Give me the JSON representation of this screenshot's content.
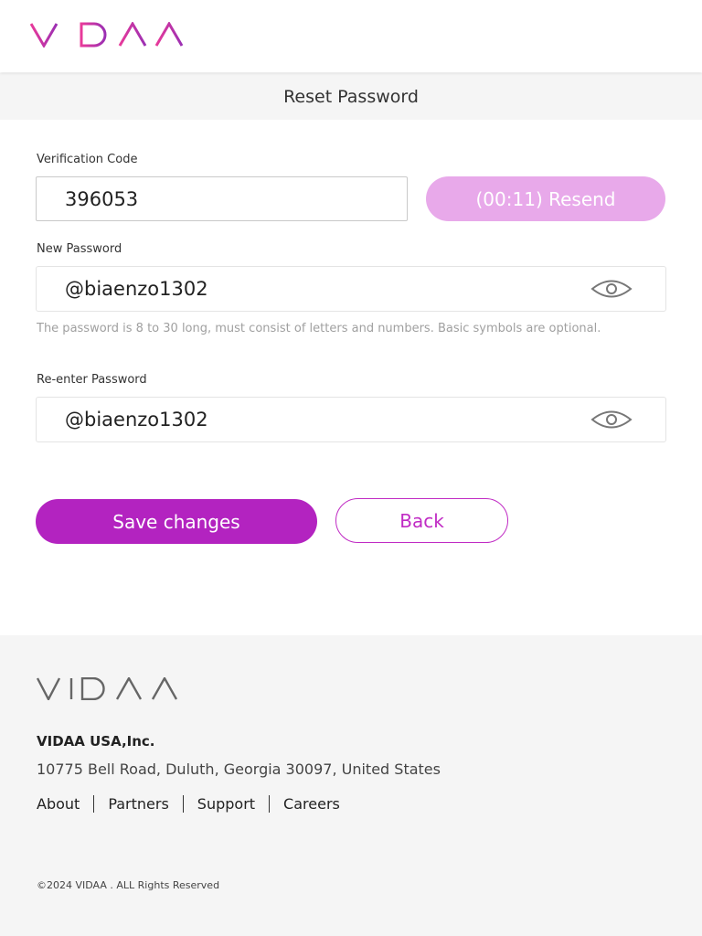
{
  "header": {
    "logo_text": "VIDAA",
    "colors": {
      "logo_gradient_start": "#e83a9a",
      "logo_gradient_end": "#9b2fb3"
    }
  },
  "page_title": "Reset Password",
  "form": {
    "verification_label": "Verification Code",
    "verification_value": "396053",
    "resend_label": "(00:11) Resend",
    "new_password_label": "New Password",
    "new_password_value": "@biaenzo1302",
    "password_hint": "The password is 8 to 30 long, must consist of letters and numbers. Basic symbols are optional.",
    "reenter_label": "Re-enter Password",
    "reenter_value": "@biaenzo1302",
    "eye_icon": "eye-icon"
  },
  "actions": {
    "save_label": "Save changes",
    "back_label": "Back",
    "colors": {
      "primary": "#b323c0",
      "resend_disabled": "#e8a9ea"
    }
  },
  "footer": {
    "logo_text": "VIDAA",
    "company": "VIDAA USA,Inc.",
    "address": "10775 Bell Road, Duluth, Georgia 30097, United States",
    "links": [
      "About",
      "Partners",
      "Support",
      "Careers"
    ],
    "copyright": "©2024 VIDAA . ALL Rights Reserved"
  }
}
